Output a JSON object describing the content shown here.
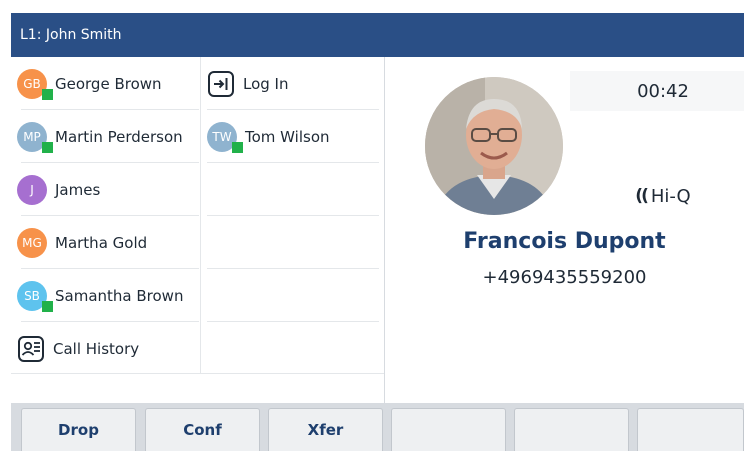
{
  "title_bar": {
    "line_label": "L1: John Smith"
  },
  "contacts": {
    "column1": [
      {
        "label": "George Brown",
        "initials": "GB",
        "color": "#f7924a",
        "presence": true
      },
      {
        "label": "Martin Perderson",
        "initials": "MP",
        "color": "#8fb3cf",
        "presence": true
      },
      {
        "label": "James",
        "initials": "J",
        "color": "#a66fd0",
        "presence": false
      },
      {
        "label": "Martha Gold",
        "initials": "MG",
        "color": "#f7924a",
        "presence": false
      },
      {
        "label": "Samantha Brown",
        "initials": "SB",
        "color": "#5ec3ee",
        "presence": true
      },
      {
        "label": "Call History",
        "icon": "call-history-icon"
      }
    ],
    "column2": [
      {
        "label": "Log In",
        "icon": "login-icon"
      },
      {
        "label": "Tom Wilson",
        "initials": "TW",
        "color": "#8fb3cf",
        "presence": true
      }
    ]
  },
  "call": {
    "timer": "00:42",
    "audio_quality": "Hi-Q",
    "audio_icon": "hi-q-audio-icon",
    "caller_name": "Francois Dupont",
    "caller_number": "+4969435559200"
  },
  "softkeys": [
    "Drop",
    "Conf",
    "Xfer",
    "",
    "",
    ""
  ],
  "colors": {
    "title_bar": "#2a4f86",
    "accent_text": "#1e3f6e",
    "presence_available": "#21b14a",
    "softkey_bar": "#d7dbe0"
  }
}
